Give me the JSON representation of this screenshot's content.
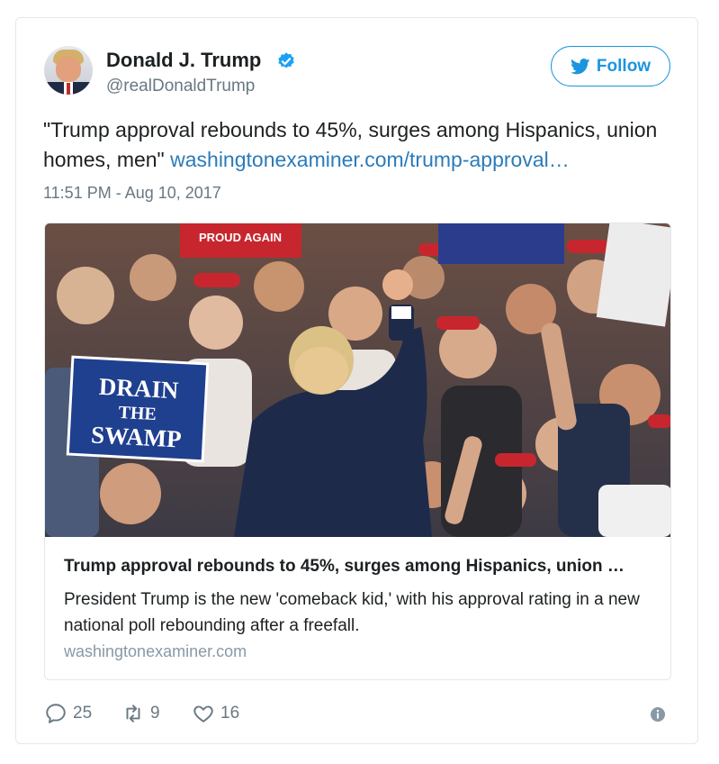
{
  "author": {
    "name": "Donald J. Trump",
    "handle": "@realDonaldTrump"
  },
  "follow_button": {
    "label": "Follow",
    "icon": "twitter-bird-icon",
    "color": "#1b95e0"
  },
  "tweet": {
    "text": "\"Trump approval rebounds to 45%, surges among Hispanics, union homes, men\"",
    "link": "washingtonexaminer.com/trump-approval…",
    "timestamp": "11:51 PM - Aug 10, 2017"
  },
  "link_card": {
    "photo_signs": {
      "drain_line1": "DRAIN",
      "drain_line2": "THE",
      "drain_line3": "SWAMP",
      "proud": "PROUD AGAIN"
    },
    "title": "Trump approval rebounds to 45%, surges among Hispanics, union …",
    "description": "President Trump is the new 'comeback kid,' with his approval rating in a new national poll rebounding after a freefall.",
    "domain": "washingtonexaminer.com"
  },
  "actions": {
    "replies": "25",
    "retweets": "9",
    "likes": "16"
  },
  "colors": {
    "link": "#2b7bb9",
    "muted": "#697882",
    "border": "#e1e8ed"
  }
}
